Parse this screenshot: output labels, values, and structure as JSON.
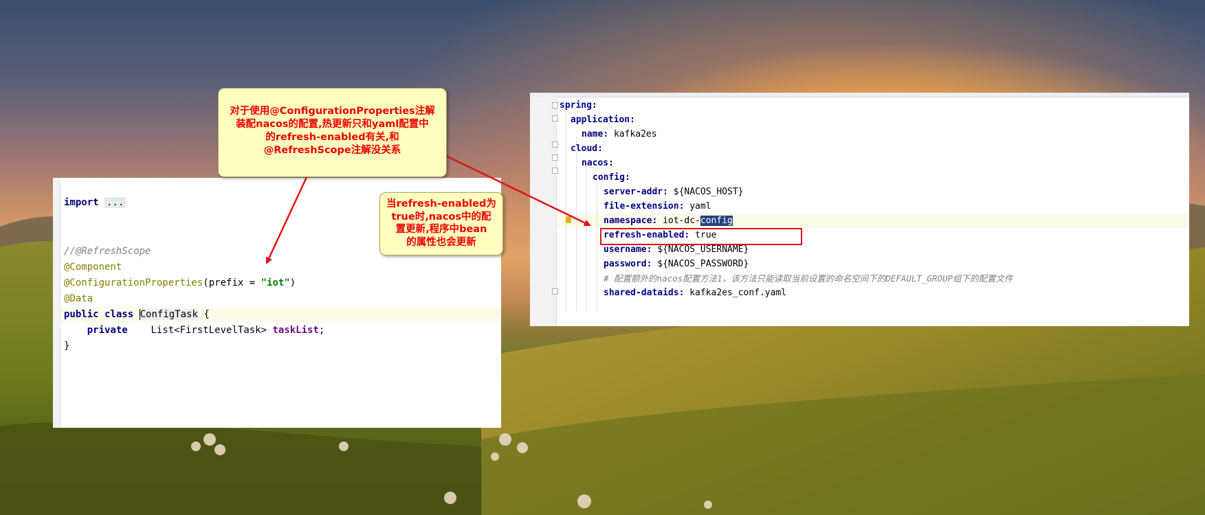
{
  "java_editor": {
    "lines": [
      {
        "type": "import",
        "keyword": "import",
        "folded": "..."
      },
      {
        "type": "comment",
        "text": "//@RefreshScope"
      },
      {
        "type": "annotation",
        "text": "@Component"
      },
      {
        "type": "annotation_call",
        "name": "@ConfigurationProperties",
        "open": "(prefix = ",
        "value": "\"iot\"",
        "close": ")"
      },
      {
        "type": "annotation",
        "text": "@Data"
      },
      {
        "type": "class_decl",
        "kw1": "public",
        "kw2": "class",
        "name": "ConfigTask",
        "brace": "{"
      },
      {
        "type": "field",
        "modifier": "private",
        "field_type": "List<FirstLevelTask>",
        "name": "taskList",
        "end": ";"
      },
      {
        "type": "close",
        "text": "}"
      }
    ]
  },
  "yaml_editor": {
    "lines": [
      {
        "key": "spring",
        "value": ""
      },
      {
        "key": "application",
        "value": ""
      },
      {
        "key": "name",
        "value": "kafka2es"
      },
      {
        "key": "cloud",
        "value": ""
      },
      {
        "key": "nacos",
        "value": ""
      },
      {
        "key": "config",
        "value": ""
      },
      {
        "key": "server-addr",
        "value": "${NACOS_HOST}"
      },
      {
        "key": "file-extension",
        "value": "yaml"
      },
      {
        "key": "namespace",
        "value": "iot-dc-",
        "selected": "config"
      },
      {
        "key": "refresh-enabled",
        "value": "true",
        "highlighted": true
      },
      {
        "key": "username",
        "value": "${NACOS_USERNAME}"
      },
      {
        "key": "password",
        "value": "${NACOS_PASSWORD}"
      },
      {
        "comment": "# 配置额外的nacos配置方法1，该方法只能读取当前设置的命名空间下的DEFAULT_GROUP组下的配置文件"
      },
      {
        "key": "shared-dataids",
        "value": "kafka2es_conf.yaml"
      }
    ]
  },
  "callouts": {
    "note1": [
      "对于使用@ConfigurationProperties注解",
      "装配nacos的配置,热更新只和yaml配置中",
      "的refresh-enabled有关,和",
      "@RefreshScope注解没关系"
    ],
    "note2": [
      "当refresh-enabled为",
      "true时,nacos中的配",
      "置更新,程序中bean",
      "的属性也会更新"
    ]
  },
  "colors": {
    "annotation_text": "#ee0000",
    "callout_bg": "#ffffc0",
    "highlight_box": "#e01414",
    "selection": "#214283"
  }
}
